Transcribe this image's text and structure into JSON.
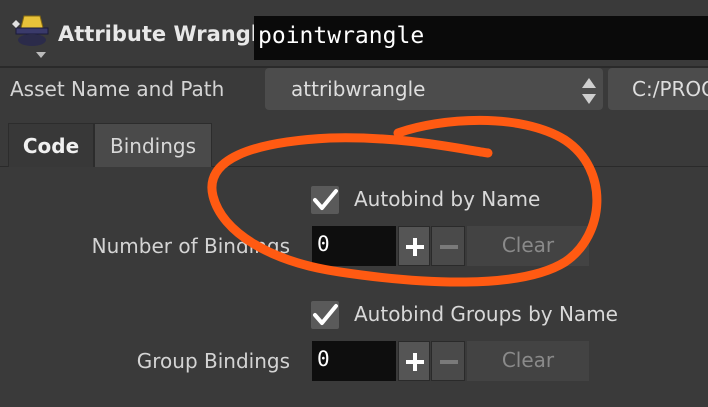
{
  "header": {
    "node_icon": "wizard-hat-icon",
    "node_type": "Attribute Wrangle",
    "node_name": "pointwrangle"
  },
  "asset": {
    "label": "Asset Name and Path",
    "name_value": "attribwrangle",
    "path_value": "C:/PROG",
    "arrows_icon": "updown-arrows-icon"
  },
  "tabs": [
    {
      "label": "Code",
      "active": true
    },
    {
      "label": "Bindings",
      "active": false
    }
  ],
  "bindings": {
    "autobind_label": "Autobind by Name",
    "autobind_checked": true,
    "count_label": "Number of Bindings",
    "count_value": "0",
    "clear_label": "Clear"
  },
  "groups": {
    "autobind_label": "Autobind Groups by Name",
    "autobind_checked": true,
    "count_label": "Group Bindings",
    "count_value": "0",
    "clear_label": "Clear"
  },
  "colors": {
    "annotation": "#ff5a12",
    "background": "#3a3a3a"
  }
}
